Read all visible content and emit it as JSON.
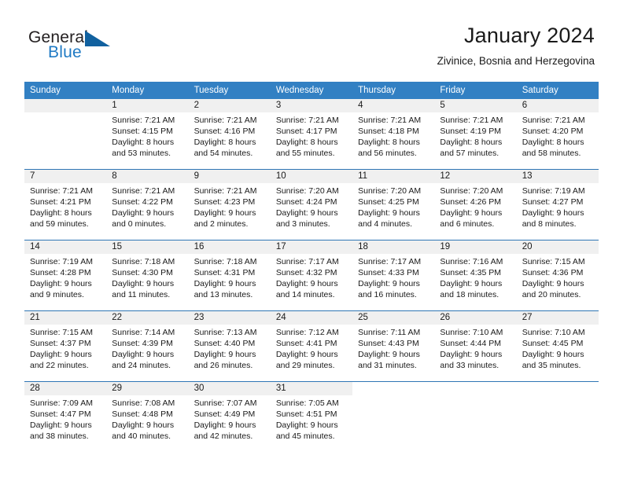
{
  "brand": {
    "name_part1": "General",
    "name_part2": "Blue",
    "logo_icon": "triangle-logo-icon"
  },
  "header": {
    "title": "January 2024",
    "subtitle": "Zivinice, Bosnia and Herzegovina"
  },
  "theme": {
    "header_blue": "#3280c3",
    "separator_blue": "#2f76b5",
    "day_band_gray": "#f0f0f0",
    "brand_blue": "#1f7ac4",
    "brand_dark_blue": "#11619f",
    "text": "#1a1a1a"
  },
  "weekdays": [
    "Sunday",
    "Monday",
    "Tuesday",
    "Wednesday",
    "Thursday",
    "Friday",
    "Saturday"
  ],
  "weeks": [
    [
      {
        "day": "",
        "lines": []
      },
      {
        "day": "1",
        "lines": [
          "Sunrise: 7:21 AM",
          "Sunset: 4:15 PM",
          "Daylight: 8 hours",
          "and 53 minutes."
        ]
      },
      {
        "day": "2",
        "lines": [
          "Sunrise: 7:21 AM",
          "Sunset: 4:16 PM",
          "Daylight: 8 hours",
          "and 54 minutes."
        ]
      },
      {
        "day": "3",
        "lines": [
          "Sunrise: 7:21 AM",
          "Sunset: 4:17 PM",
          "Daylight: 8 hours",
          "and 55 minutes."
        ]
      },
      {
        "day": "4",
        "lines": [
          "Sunrise: 7:21 AM",
          "Sunset: 4:18 PM",
          "Daylight: 8 hours",
          "and 56 minutes."
        ]
      },
      {
        "day": "5",
        "lines": [
          "Sunrise: 7:21 AM",
          "Sunset: 4:19 PM",
          "Daylight: 8 hours",
          "and 57 minutes."
        ]
      },
      {
        "day": "6",
        "lines": [
          "Sunrise: 7:21 AM",
          "Sunset: 4:20 PM",
          "Daylight: 8 hours",
          "and 58 minutes."
        ]
      }
    ],
    [
      {
        "day": "7",
        "lines": [
          "Sunrise: 7:21 AM",
          "Sunset: 4:21 PM",
          "Daylight: 8 hours",
          "and 59 minutes."
        ]
      },
      {
        "day": "8",
        "lines": [
          "Sunrise: 7:21 AM",
          "Sunset: 4:22 PM",
          "Daylight: 9 hours",
          "and 0 minutes."
        ]
      },
      {
        "day": "9",
        "lines": [
          "Sunrise: 7:21 AM",
          "Sunset: 4:23 PM",
          "Daylight: 9 hours",
          "and 2 minutes."
        ]
      },
      {
        "day": "10",
        "lines": [
          "Sunrise: 7:20 AM",
          "Sunset: 4:24 PM",
          "Daylight: 9 hours",
          "and 3 minutes."
        ]
      },
      {
        "day": "11",
        "lines": [
          "Sunrise: 7:20 AM",
          "Sunset: 4:25 PM",
          "Daylight: 9 hours",
          "and 4 minutes."
        ]
      },
      {
        "day": "12",
        "lines": [
          "Sunrise: 7:20 AM",
          "Sunset: 4:26 PM",
          "Daylight: 9 hours",
          "and 6 minutes."
        ]
      },
      {
        "day": "13",
        "lines": [
          "Sunrise: 7:19 AM",
          "Sunset: 4:27 PM",
          "Daylight: 9 hours",
          "and 8 minutes."
        ]
      }
    ],
    [
      {
        "day": "14",
        "lines": [
          "Sunrise: 7:19 AM",
          "Sunset: 4:28 PM",
          "Daylight: 9 hours",
          "and 9 minutes."
        ]
      },
      {
        "day": "15",
        "lines": [
          "Sunrise: 7:18 AM",
          "Sunset: 4:30 PM",
          "Daylight: 9 hours",
          "and 11 minutes."
        ]
      },
      {
        "day": "16",
        "lines": [
          "Sunrise: 7:18 AM",
          "Sunset: 4:31 PM",
          "Daylight: 9 hours",
          "and 13 minutes."
        ]
      },
      {
        "day": "17",
        "lines": [
          "Sunrise: 7:17 AM",
          "Sunset: 4:32 PM",
          "Daylight: 9 hours",
          "and 14 minutes."
        ]
      },
      {
        "day": "18",
        "lines": [
          "Sunrise: 7:17 AM",
          "Sunset: 4:33 PM",
          "Daylight: 9 hours",
          "and 16 minutes."
        ]
      },
      {
        "day": "19",
        "lines": [
          "Sunrise: 7:16 AM",
          "Sunset: 4:35 PM",
          "Daylight: 9 hours",
          "and 18 minutes."
        ]
      },
      {
        "day": "20",
        "lines": [
          "Sunrise: 7:15 AM",
          "Sunset: 4:36 PM",
          "Daylight: 9 hours",
          "and 20 minutes."
        ]
      }
    ],
    [
      {
        "day": "21",
        "lines": [
          "Sunrise: 7:15 AM",
          "Sunset: 4:37 PM",
          "Daylight: 9 hours",
          "and 22 minutes."
        ]
      },
      {
        "day": "22",
        "lines": [
          "Sunrise: 7:14 AM",
          "Sunset: 4:39 PM",
          "Daylight: 9 hours",
          "and 24 minutes."
        ]
      },
      {
        "day": "23",
        "lines": [
          "Sunrise: 7:13 AM",
          "Sunset: 4:40 PM",
          "Daylight: 9 hours",
          "and 26 minutes."
        ]
      },
      {
        "day": "24",
        "lines": [
          "Sunrise: 7:12 AM",
          "Sunset: 4:41 PM",
          "Daylight: 9 hours",
          "and 29 minutes."
        ]
      },
      {
        "day": "25",
        "lines": [
          "Sunrise: 7:11 AM",
          "Sunset: 4:43 PM",
          "Daylight: 9 hours",
          "and 31 minutes."
        ]
      },
      {
        "day": "26",
        "lines": [
          "Sunrise: 7:10 AM",
          "Sunset: 4:44 PM",
          "Daylight: 9 hours",
          "and 33 minutes."
        ]
      },
      {
        "day": "27",
        "lines": [
          "Sunrise: 7:10 AM",
          "Sunset: 4:45 PM",
          "Daylight: 9 hours",
          "and 35 minutes."
        ]
      }
    ],
    [
      {
        "day": "28",
        "lines": [
          "Sunrise: 7:09 AM",
          "Sunset: 4:47 PM",
          "Daylight: 9 hours",
          "and 38 minutes."
        ]
      },
      {
        "day": "29",
        "lines": [
          "Sunrise: 7:08 AM",
          "Sunset: 4:48 PM",
          "Daylight: 9 hours",
          "and 40 minutes."
        ]
      },
      {
        "day": "30",
        "lines": [
          "Sunrise: 7:07 AM",
          "Sunset: 4:49 PM",
          "Daylight: 9 hours",
          "and 42 minutes."
        ]
      },
      {
        "day": "31",
        "lines": [
          "Sunrise: 7:05 AM",
          "Sunset: 4:51 PM",
          "Daylight: 9 hours",
          "and 45 minutes."
        ]
      },
      {
        "day": "",
        "lines": []
      },
      {
        "day": "",
        "lines": []
      },
      {
        "day": "",
        "lines": []
      }
    ]
  ]
}
